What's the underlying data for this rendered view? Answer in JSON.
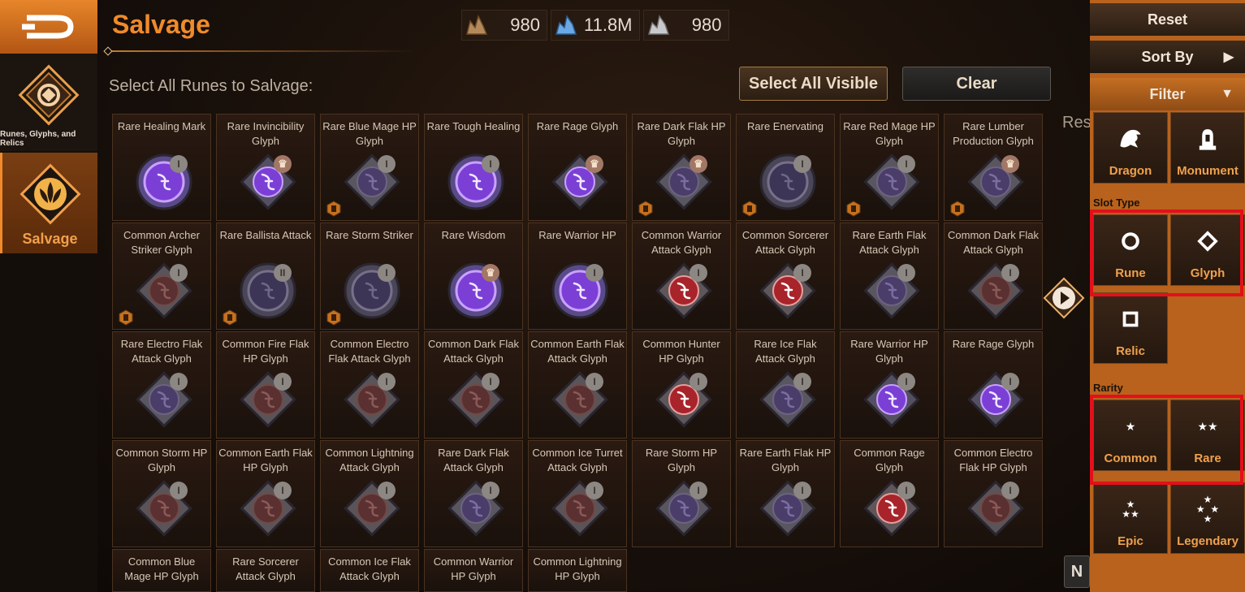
{
  "nav": {
    "tabs": [
      {
        "label": "Runes, Glyphs, and Relics"
      },
      {
        "label": "Salvage"
      }
    ]
  },
  "header": {
    "title": "Salvage",
    "currencies": [
      {
        "icon": "crystal-ore-icon",
        "value": "980"
      },
      {
        "icon": "blue-crystal-icon",
        "value": "11.8M"
      },
      {
        "icon": "silver-crystal-icon",
        "value": "980"
      }
    ]
  },
  "toolbar": {
    "select_all_label": "Select All Runes to Salvage:",
    "select_visible_label": "Select All Visible",
    "clear_label": "Clear",
    "res_label": "Res",
    "n_label": "N"
  },
  "items": [
    {
      "name": "Rare Healing Mark",
      "badge": "i",
      "style": "rare-rune"
    },
    {
      "name": "Rare Invincibility Glyph",
      "badge": "crown",
      "style": "rare-glyph"
    },
    {
      "name": "Rare Blue Mage HP Glyph",
      "badge": "i",
      "style": "dim-glyph"
    },
    {
      "name": "Rare Tough Healing",
      "badge": "i",
      "style": "rare-rune"
    },
    {
      "name": "Rare Rage Glyph",
      "badge": "crown",
      "style": "rare-glyph"
    },
    {
      "name": "Rare Dark Flak HP Glyph",
      "badge": "crown",
      "style": "dim-glyph"
    },
    {
      "name": "Rare Enervating",
      "badge": "i",
      "style": "dim-rune"
    },
    {
      "name": "Rare Red Mage HP Glyph",
      "badge": "i",
      "style": "dim-glyph"
    },
    {
      "name": "Rare Lumber Production Glyph",
      "badge": "crown",
      "style": "dim-glyph"
    },
    {
      "name": "Common Archer Striker Glyph",
      "badge": "i",
      "style": "common-glyph"
    },
    {
      "name": "Rare Ballista Attack",
      "badge": "ii",
      "style": "dim-rune"
    },
    {
      "name": "Rare Storm Striker",
      "badge": "i",
      "style": "dim-rune"
    },
    {
      "name": "Rare Wisdom",
      "badge": "crown",
      "style": "rare-rune"
    },
    {
      "name": "Rare Warrior HP",
      "badge": "i",
      "style": "rare-rune"
    },
    {
      "name": "Common Warrior Attack Glyph",
      "badge": "i",
      "style": "red-glyph"
    },
    {
      "name": "Common Sorcerer Attack Glyph",
      "badge": "i",
      "style": "red-glyph"
    },
    {
      "name": "Rare Earth Flak Attack Glyph",
      "badge": "i",
      "style": "dim-glyph"
    },
    {
      "name": "Common Dark Flak Attack Glyph",
      "badge": "i",
      "style": "common-glyph"
    },
    {
      "name": "Rare Electro Flak Attack Glyph",
      "badge": "i",
      "style": "dim-glyph"
    },
    {
      "name": "Common Fire Flak HP Glyph",
      "badge": "i",
      "style": "common-glyph"
    },
    {
      "name": "Common Electro Flak Attack Glyph",
      "badge": "i",
      "style": "common-glyph"
    },
    {
      "name": "Common Dark Flak Attack Glyph",
      "badge": "i",
      "style": "common-glyph"
    },
    {
      "name": "Common Earth Flak Attack Glyph",
      "badge": "i",
      "style": "common-glyph"
    },
    {
      "name": "Common Hunter HP Glyph",
      "badge": "i",
      "style": "red-glyph"
    },
    {
      "name": "Rare Ice Flak Attack Glyph",
      "badge": "i",
      "style": "dim-glyph"
    },
    {
      "name": "Rare Warrior HP Glyph",
      "badge": "i",
      "style": "rare-glyph"
    },
    {
      "name": "Rare Rage Glyph",
      "badge": "i",
      "style": "rare-glyph"
    },
    {
      "name": "Common Storm HP Glyph",
      "badge": "i",
      "style": "common-glyph"
    },
    {
      "name": "Common Earth Flak HP Glyph",
      "badge": "i",
      "style": "common-glyph"
    },
    {
      "name": "Common Lightning Attack Glyph",
      "badge": "i",
      "style": "common-glyph"
    },
    {
      "name": "Rare Dark Flak Attack Glyph",
      "badge": "i",
      "style": "dim-glyph"
    },
    {
      "name": "Common Ice Turret Attack Glyph",
      "badge": "i",
      "style": "common-glyph"
    },
    {
      "name": "Rare Storm HP Glyph",
      "badge": "i",
      "style": "dim-glyph"
    },
    {
      "name": "Rare Earth Flak HP Glyph",
      "badge": "i",
      "style": "dim-glyph"
    },
    {
      "name": "Common Rage Glyph",
      "badge": "i",
      "style": "red-glyph"
    },
    {
      "name": "Common Electro Flak HP Glyph",
      "badge": "i",
      "style": "common-glyph"
    },
    {
      "name": "Common Blue Mage HP Glyph",
      "badge": "",
      "style": "common-glyph"
    },
    {
      "name": "Rare Sorcerer Attack Glyph",
      "badge": "",
      "style": "dim-glyph"
    },
    {
      "name": "Common Ice Flak Attack Glyph",
      "badge": "",
      "style": "common-glyph"
    },
    {
      "name": "Common Warrior HP Glyph",
      "badge": "",
      "style": "common-glyph"
    },
    {
      "name": "Common Lightning HP Glyph",
      "badge": "",
      "style": "common-glyph"
    }
  ],
  "filters": {
    "reset_label": "Reset",
    "sort_label": "Sort By",
    "filter_label": "Filter",
    "categories": [
      {
        "label": "Dragon",
        "icon": "dragon-icon"
      },
      {
        "label": "Monument",
        "icon": "monument-icon"
      }
    ],
    "slot_type_heading": "Slot Type",
    "slot_types": [
      {
        "label": "Rune",
        "icon": "circle-icon"
      },
      {
        "label": "Glyph",
        "icon": "diamond-icon"
      },
      {
        "label": "Relic",
        "icon": "square-icon"
      }
    ],
    "rarity_heading": "Rarity",
    "rarities": [
      {
        "label": "Common",
        "icon": "one-star-icon"
      },
      {
        "label": "Rare",
        "icon": "two-stars-icon"
      },
      {
        "label": "Epic",
        "icon": "three-stars-icon"
      },
      {
        "label": "Legendary",
        "icon": "four-stars-icon"
      }
    ]
  },
  "colors": {
    "accent": "#f08a2a",
    "highlight_box": "#e3101b",
    "rare_purple": "#7b3fd6",
    "common_red": "#8a2f2b"
  }
}
